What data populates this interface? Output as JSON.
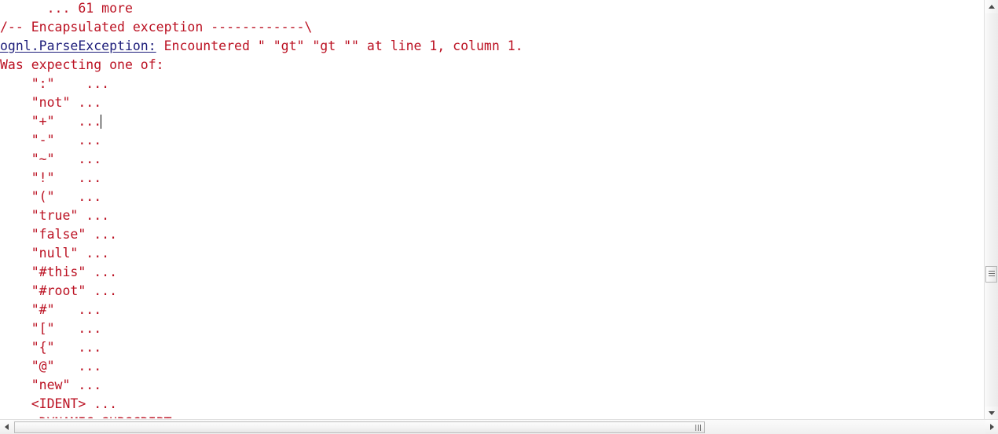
{
  "console": {
    "text_color": "#bb1122",
    "link_color": "#1d1d7a",
    "background": "#ffffff",
    "lines": [
      {
        "id": "more-frames",
        "text": "      ... 61 more"
      },
      {
        "id": "encapsulated-banner",
        "text": "/-- Encapsulated exception ------------\\"
      },
      {
        "id": "exception-header",
        "link": "ognl.ParseException:",
        "text": " Encountered \" \"gt\" \"gt \"\" at line 1, column 1."
      },
      {
        "id": "was-expecting",
        "text": "Was expecting one of:"
      },
      {
        "id": "token-colon",
        "text": "    \":\"    ..."
      },
      {
        "id": "token-not",
        "text": "    \"not\" ..."
      },
      {
        "id": "token-plus",
        "text": "    \"+\"   ...",
        "caret": true
      },
      {
        "id": "token-minus",
        "text": "    \"-\"   ..."
      },
      {
        "id": "token-tilde",
        "text": "    \"~\"   ..."
      },
      {
        "id": "token-bang",
        "text": "    \"!\"   ..."
      },
      {
        "id": "token-lparen",
        "text": "    \"(\"   ..."
      },
      {
        "id": "token-true",
        "text": "    \"true\" ..."
      },
      {
        "id": "token-false",
        "text": "    \"false\" ..."
      },
      {
        "id": "token-null",
        "text": "    \"null\" ..."
      },
      {
        "id": "token-this",
        "text": "    \"#this\" ..."
      },
      {
        "id": "token-root",
        "text": "    \"#root\" ..."
      },
      {
        "id": "token-hash",
        "text": "    \"#\"   ..."
      },
      {
        "id": "token-lbracket",
        "text": "    \"[\"   ..."
      },
      {
        "id": "token-lbrace",
        "text": "    \"{\"   ..."
      },
      {
        "id": "token-at",
        "text": "    \"@\"   ..."
      },
      {
        "id": "token-new",
        "text": "    \"new\" ..."
      },
      {
        "id": "token-ident",
        "text": "    <IDENT> ..."
      },
      {
        "id": "token-dynamic-subscript",
        "text": "    <DYNAMIC_SUBSCRIPT>"
      }
    ]
  },
  "scrollbars": {
    "vertical": {
      "up_icon": "arrow-up-icon",
      "down_icon": "arrow-down-icon",
      "thumb_icon": "grip-icon"
    },
    "horizontal": {
      "left_icon": "arrow-left-icon",
      "right_icon": "arrow-right-icon",
      "thumb_icon": "grip-icon"
    }
  }
}
